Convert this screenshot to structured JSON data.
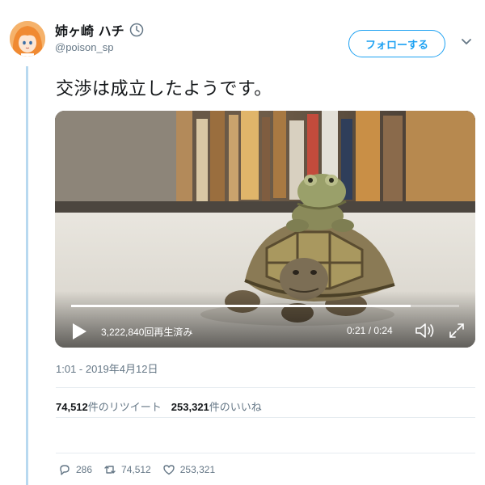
{
  "user": {
    "display_name": "姉ヶ崎 ハチ",
    "handle": "@poison_sp"
  },
  "follow_label": "フォローする",
  "tweet_text": "交渉は成立したようです。",
  "video": {
    "view_count": "3,222,840回再生済み",
    "time": "0:21 / 0:24",
    "progress": 0.875
  },
  "timestamp": "1:01 - 2019年4月12日",
  "stats": {
    "retweets": "74,512",
    "retweets_label": "件のリツイート",
    "likes": "253,321",
    "likes_label": "件のいいね"
  },
  "actions": {
    "replies": "286",
    "retweets": "74,512",
    "likes": "253,321"
  },
  "colors": {
    "accent": "#1da1f2",
    "muted": "#657786",
    "thread_line": "#b8d9f0"
  }
}
